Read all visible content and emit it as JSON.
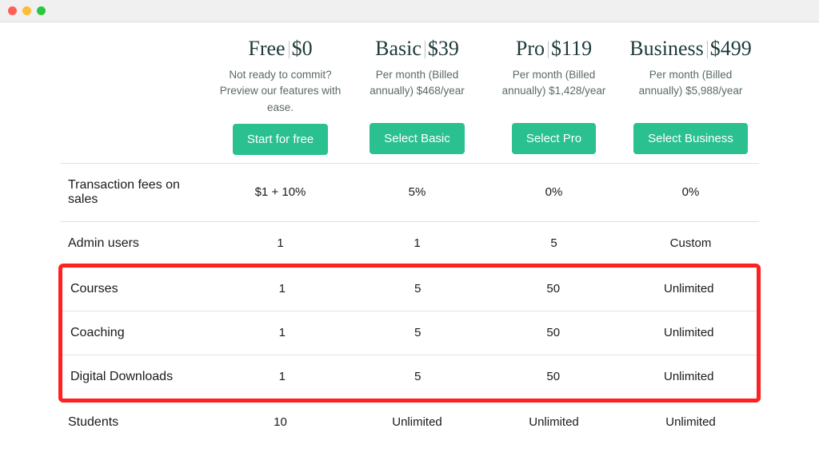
{
  "plans": [
    {
      "name": "Free",
      "price": "$0",
      "subtitle": "Not ready to commit? Preview our features with ease.",
      "button": "Start for free"
    },
    {
      "name": "Basic",
      "price": "$39",
      "subtitle": "Per month (Billed annually) $468/year",
      "button": "Select Basic"
    },
    {
      "name": "Pro",
      "price": "$119",
      "subtitle": "Per month (Billed annually) $1,428/year",
      "button": "Select Pro"
    },
    {
      "name": "Business",
      "price": "$499",
      "subtitle": "Per month (Billed annually) $5,988/year",
      "button": "Select Business"
    }
  ],
  "rows": [
    {
      "label": "Transaction fees on sales",
      "values": [
        "$1 + 10%",
        "5%",
        "0%",
        "0%"
      ]
    },
    {
      "label": "Admin users",
      "values": [
        "1",
        "1",
        "5",
        "Custom"
      ]
    },
    {
      "label": "Courses",
      "values": [
        "1",
        "5",
        "50",
        "Unlimited"
      ],
      "highlighted": true
    },
    {
      "label": "Coaching",
      "values": [
        "1",
        "5",
        "50",
        "Unlimited"
      ],
      "highlighted": true
    },
    {
      "label": "Digital Downloads",
      "values": [
        "1",
        "5",
        "50",
        "Unlimited"
      ],
      "highlighted": true
    },
    {
      "label": "Students",
      "values": [
        "10",
        "Unlimited",
        "Unlimited",
        "Unlimited"
      ]
    }
  ]
}
